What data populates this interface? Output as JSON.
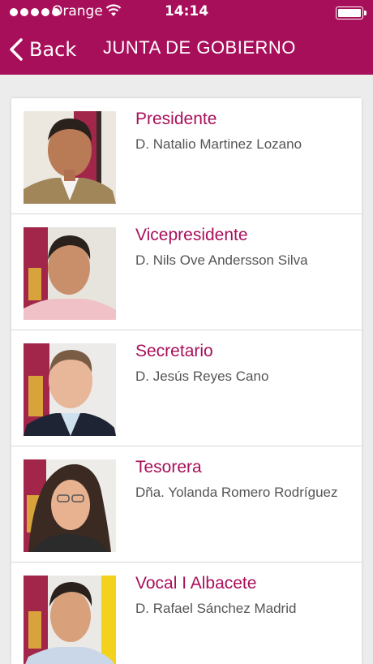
{
  "status_bar": {
    "carrier": "Orange",
    "time": "14:14",
    "signal_bars": 5,
    "icons": [
      "signal-icon",
      "wifi-icon",
      "battery-icon"
    ]
  },
  "nav": {
    "back_label": "Back",
    "title": "JUNTA DE GOBIERNO",
    "background_color": "#a80f5a"
  },
  "members": [
    {
      "role": "Presidente",
      "name": "D. Natalio Martinez Lozano"
    },
    {
      "role": "Vicepresidente",
      "name": "D. Nils Ove Andersson Silva"
    },
    {
      "role": "Secretario",
      "name": "D. Jesús Reyes Cano"
    },
    {
      "role": "Tesorera",
      "name": "Dña. Yolanda Romero Rodríguez"
    },
    {
      "role": "Vocal I Albacete",
      "name": "D. Rafael Sánchez Madrid"
    }
  ],
  "accent_color": "#a80f5a"
}
